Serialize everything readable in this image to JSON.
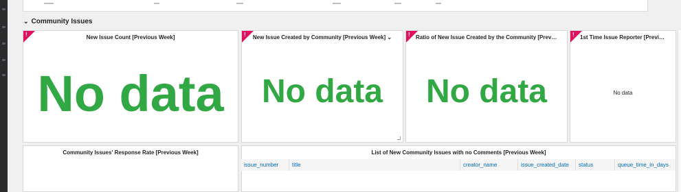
{
  "row": {
    "chevron": "⌄",
    "title": "Community Issues"
  },
  "panels": {
    "new_issue_count": {
      "title": "New Issue Count [Previous Week]",
      "nodata": "No data"
    },
    "new_issue_created": {
      "title": "New Issue Created by Community [Previous Week]",
      "menu_icon": "chevron-down-icon",
      "nodata": "No data"
    },
    "ratio_new_issue": {
      "title": "Ratio of New Issue Created by the Community [Previous ...",
      "nodata": "No data"
    },
    "first_time_reporter": {
      "title": "1st Time Issue Reporter [Previous ...",
      "nodata": "No data"
    },
    "response_rate": {
      "title": "Community Issues' Response Rate [Previous Week]"
    },
    "no_comments_list": {
      "title": "List of New Community Issues with no Comments [Previous Week]",
      "columns": [
        "issue_number",
        "title",
        "creator_name",
        "issue_created_date",
        "status",
        "queue_time_in_days"
      ]
    }
  },
  "colors": {
    "alert_corner": "#e0115f",
    "nodata_green": "#32a845",
    "link_blue": "#006bb4"
  }
}
